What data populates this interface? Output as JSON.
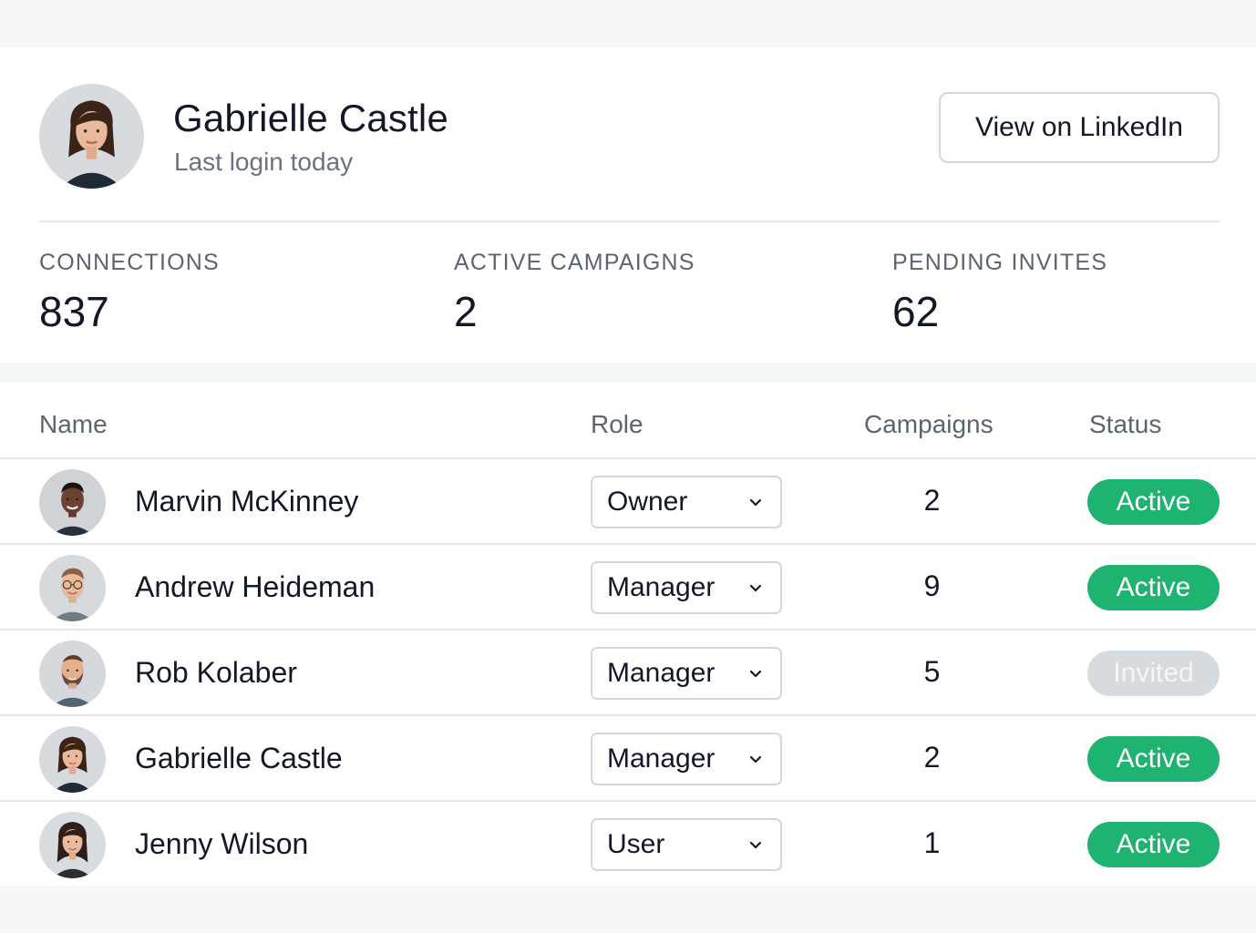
{
  "profile": {
    "name": "Gabrielle Castle",
    "subtitle": "Last login today",
    "linkedin_label": "View on LinkedIn"
  },
  "stats": [
    {
      "label": "CONNECTIONS",
      "value": "837"
    },
    {
      "label": "ACTIVE CAMPAIGNS",
      "value": "2"
    },
    {
      "label": "PENDING INVITES",
      "value": "62"
    }
  ],
  "table": {
    "headers": {
      "name": "Name",
      "role": "Role",
      "campaigns": "Campaigns",
      "status": "Status"
    },
    "rows": [
      {
        "name": "Marvin McKinney",
        "role": "Owner",
        "campaigns": "2",
        "status": "Active"
      },
      {
        "name": "Andrew Heideman",
        "role": "Manager",
        "campaigns": "9",
        "status": "Active"
      },
      {
        "name": "Rob Kolaber",
        "role": "Manager",
        "campaigns": "5",
        "status": "Invited"
      },
      {
        "name": "Gabrielle Castle",
        "role": "Manager",
        "campaigns": "2",
        "status": "Active"
      },
      {
        "name": "Jenny Wilson",
        "role": "User",
        "campaigns": "1",
        "status": "Active"
      }
    ]
  },
  "colors": {
    "active": "#1fb371",
    "invited": "#d6dbe0",
    "border": "#d4d8de",
    "muted_text": "#5b6472"
  },
  "icons": {
    "select_caret": "chevron-down-icon"
  }
}
